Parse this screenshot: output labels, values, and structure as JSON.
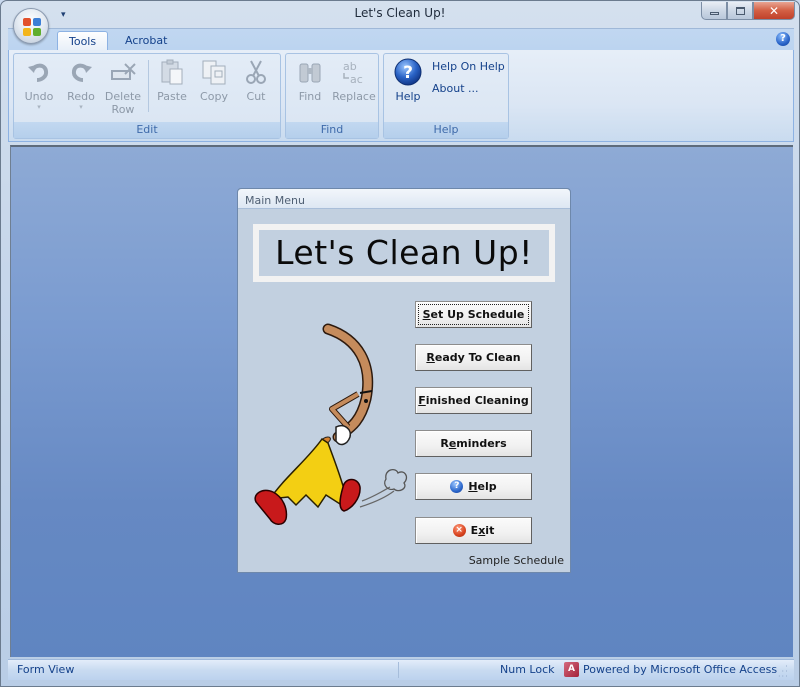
{
  "window": {
    "title": "Let's Clean Up!",
    "controls": {
      "minimize": "minimize",
      "maximize": "maximize",
      "close": "close"
    }
  },
  "quick_access": {
    "customize_glyph": "▾"
  },
  "ribbon": {
    "tabs": [
      {
        "label": "Tools",
        "active": true
      },
      {
        "label": "Acrobat",
        "active": false
      }
    ],
    "help_glyph": "?",
    "groups": {
      "edit": {
        "label": "Edit",
        "buttons": [
          {
            "label": "Undo",
            "icon": "undo-icon",
            "enabled": false,
            "has_dropdown": true
          },
          {
            "label": "Redo",
            "icon": "redo-icon",
            "enabled": false,
            "has_dropdown": true
          },
          {
            "label": "Delete Row",
            "label_line1": "Delete",
            "label_line2": "Row",
            "icon": "delete-row-icon",
            "enabled": false
          },
          {
            "label": "Paste",
            "icon": "paste-icon",
            "enabled": false
          },
          {
            "label": "Copy",
            "icon": "copy-icon",
            "enabled": false
          },
          {
            "label": "Cut",
            "icon": "scissors-icon",
            "enabled": false
          }
        ]
      },
      "find": {
        "label": "Find",
        "buttons": [
          {
            "label": "Find",
            "icon": "binoculars-icon",
            "enabled": false
          },
          {
            "label": "Replace",
            "icon": "replace-icon",
            "enabled": false
          }
        ]
      },
      "help": {
        "label": "Help",
        "buttons": [
          {
            "label": "Help",
            "icon": "help-icon",
            "enabled": true
          }
        ],
        "links": [
          "Help On Help",
          "About ..."
        ]
      }
    },
    "dropdown_glyph": "▾"
  },
  "form": {
    "caption": "Main Menu",
    "banner_title": "Let's Clean Up!",
    "buttons": [
      {
        "label": "Set Up Schedule",
        "accel": "S",
        "rest": "et Up Schedule",
        "pre": "",
        "focused": true
      },
      {
        "label": "Ready To Clean",
        "accel": "R",
        "rest": "eady To Clean",
        "pre": ""
      },
      {
        "label": "Finished Cleaning",
        "accel": "F",
        "rest": "inished Cleaning",
        "pre": ""
      },
      {
        "label": "Reminders",
        "accel": "e",
        "rest": "minders",
        "pre": "R"
      },
      {
        "label": "Help",
        "accel": "H",
        "rest": "elp",
        "pre": "",
        "icon": "help-icon",
        "icon_glyph": "?"
      },
      {
        "label": "Exit",
        "accel": "x",
        "rest": "it",
        "pre": "E",
        "icon": "exit-icon",
        "icon_glyph": "×"
      }
    ],
    "footer": "Sample Schedule",
    "illustration": "running-broom-cartoon"
  },
  "statusbar": {
    "view": "Form View",
    "num_lock": "Num Lock",
    "powered_by": "Powered by Microsoft Office Access",
    "access_glyph": "A"
  },
  "colors": {
    "ribbon_text": "#15428b",
    "workspace_top": "#8eaad5",
    "workspace_bottom": "#5f85c1",
    "form_background": "#c2d0e0",
    "close_button": "#c9472f"
  }
}
